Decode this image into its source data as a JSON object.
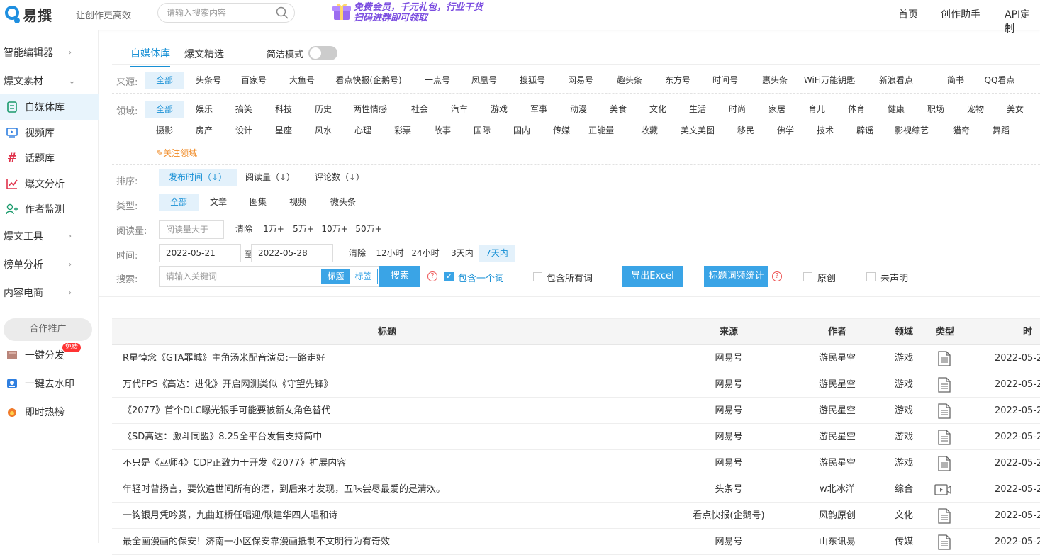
{
  "brand": {
    "name": "易撰",
    "slogan": "让创作更高效"
  },
  "top_search": {
    "placeholder": "请输入搜索内容"
  },
  "promo": {
    "line1": "免费会员，千元礼包，行业干货",
    "line2": "扫码进群即可领取"
  },
  "nav": [
    "首页",
    "创作助手",
    "API定制"
  ],
  "sidebar": {
    "groups": [
      "智能编辑器",
      "爆文素材",
      "爆文工具",
      "榜单分析",
      "内容电商"
    ],
    "sub_items": [
      {
        "label": "自媒体库",
        "icon": "document-icon"
      },
      {
        "label": "视频库",
        "icon": "video-icon"
      },
      {
        "label": "话题库",
        "icon": "hashtag-icon"
      },
      {
        "label": "爆文分析",
        "icon": "chart-icon"
      },
      {
        "label": "作者监测",
        "icon": "user-add-icon"
      }
    ],
    "coop_label": "合作推广",
    "free_badge": "免费",
    "promo_items": [
      "一键分发",
      "一键去水印",
      "即时热榜"
    ]
  },
  "tabs": [
    "自媒体库",
    "爆文精选"
  ],
  "simple_mode_label": "简洁模式",
  "filters": {
    "source_label": "来源:",
    "sources": [
      "全部",
      "头条号",
      "百家号",
      "大鱼号",
      "看点快报(企鹅号)",
      "一点号",
      "凤凰号",
      "搜狐号",
      "网易号",
      "趣头条",
      "东方号",
      "时间号",
      "惠头条",
      "WiFi万能钥匙",
      "新浪看点",
      "简书",
      "QQ看点"
    ],
    "domain_label": "领域:",
    "domains_row1": [
      "全部",
      "娱乐",
      "搞笑",
      "科技",
      "历史",
      "两性情感",
      "社会",
      "汽车",
      "游戏",
      "军事",
      "动漫",
      "美食",
      "文化",
      "生活",
      "时尚",
      "家居",
      "育儿",
      "体育",
      "健康",
      "职场",
      "宠物",
      "美女"
    ],
    "domains_row2": [
      "摄影",
      "房产",
      "设计",
      "星座",
      "风水",
      "心理",
      "彩票",
      "故事",
      "国际",
      "国内",
      "传媒",
      "正能量",
      "收藏",
      "美文美图",
      "移民",
      "佛学",
      "技术",
      "辟谣",
      "影视综艺",
      "猎奇",
      "舞蹈"
    ],
    "follow_label": "关注领域",
    "sort_label": "排序:",
    "sorts": [
      "发布时间（↓）",
      "阅读量（↓）",
      "评论数（↓）"
    ],
    "type_label": "类型:",
    "types": [
      "全部",
      "文章",
      "图集",
      "视频",
      "微头条"
    ],
    "read_label": "阅读量:",
    "read_placeholder": "阅读量大于",
    "read_options": [
      "清除",
      "1万+",
      "5万+",
      "10万+",
      "50万+"
    ],
    "time_label": "时间:",
    "time_from": "2022-05-21 00:00",
    "time_to_label": "至",
    "time_to": "2022-05-28 00:00",
    "time_options": [
      "清除",
      "12小时",
      "24小时",
      "3天内",
      "7天内"
    ],
    "search_label": "搜索:",
    "search_placeholder": "请输入关键词",
    "seg_title": "标题",
    "seg_tag": "标签",
    "search_button": "搜索",
    "contains_one": "包含一个词",
    "contains_all": "包含所有词",
    "export_button": "导出Excel",
    "stats_button": "标题词频统计",
    "original": "原创",
    "undeclared": "未声明"
  },
  "table": {
    "headers": {
      "title": "标题",
      "source": "来源",
      "author": "作者",
      "domain": "领域",
      "type": "类型",
      "time": "时"
    },
    "rows": [
      {
        "title": "R星悼念《GTA罪城》主角汤米配音演员:一路走好",
        "source": "网易号",
        "author": "游民星空",
        "domain": "游戏",
        "type": "article",
        "time": "2022-05-2"
      },
      {
        "title": "万代FPS《高达：进化》开启网测类似《守望先锋》",
        "source": "网易号",
        "author": "游民星空",
        "domain": "游戏",
        "type": "article",
        "time": "2022-05-2"
      },
      {
        "title": "《2077》首个DLC曝光银手可能要被新女角色替代",
        "source": "网易号",
        "author": "游民星空",
        "domain": "游戏",
        "type": "article",
        "time": "2022-05-2"
      },
      {
        "title": "《SD高达：激斗同盟》8.25全平台发售支持简中",
        "source": "网易号",
        "author": "游民星空",
        "domain": "游戏",
        "type": "article",
        "time": "2022-05-2"
      },
      {
        "title": "不只是《巫师4》CDP正致力于开发《2077》扩展内容",
        "source": "网易号",
        "author": "游民星空",
        "domain": "游戏",
        "type": "article",
        "time": "2022-05-2"
      },
      {
        "title": "年轻时曾扬言，要饮遍世间所有的酒，到后来才发现，五味尝尽最爱的是清欢。",
        "source": "头条号",
        "author": "w北冰洋",
        "domain": "综合",
        "type": "video",
        "time": "2022-05-2"
      },
      {
        "title": "一钩银月凭吟赏，九曲虹桥任唱迎/耿建华四人唱和诗",
        "source": "看点快报(企鹅号)",
        "author": "风韵原创",
        "domain": "文化",
        "type": "article",
        "time": "2022-05-2"
      },
      {
        "title": "最全画漫画的保安！济南一小区保安靠漫画抵制不文明行为有奇效",
        "source": "网易号",
        "author": "山东讯易",
        "domain": "传媒",
        "type": "article",
        "time": "2022-05-2"
      }
    ]
  }
}
